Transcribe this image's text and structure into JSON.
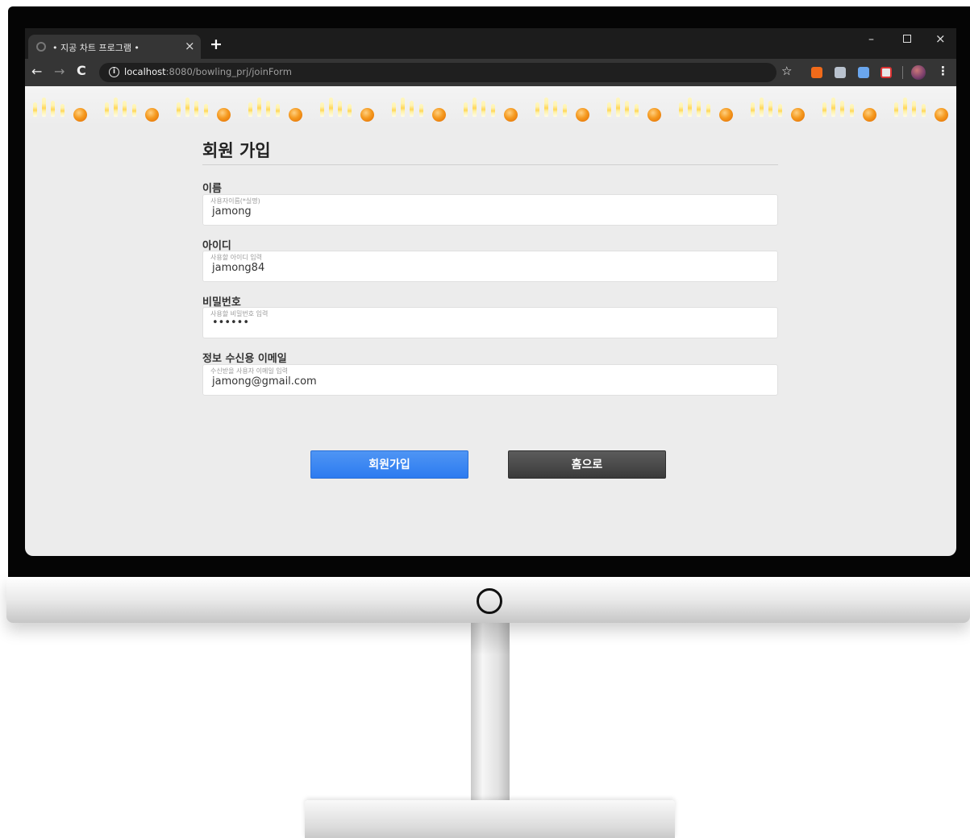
{
  "browser": {
    "tab_title": "• 지공 차트 프로그램 •",
    "tab_close": "×",
    "new_tab": "+",
    "url_host": "localhost",
    "url_path": ":8080/bowling_prj/joinForm",
    "info": "i",
    "window_controls": {
      "minimize": "–",
      "close": "×"
    },
    "nav": {
      "back": "←",
      "forward": "→",
      "reload": "C",
      "star": "☆",
      "menu": "⋮"
    },
    "extensions": [
      "ext-orange-icon",
      "ext-gray-icon",
      "ext-blue-icon",
      "ext-red-icon"
    ]
  },
  "page": {
    "title": "회원 가입",
    "fields": [
      {
        "label": "이름",
        "placeholder": "사용자이름(*실명)",
        "value": "jamong"
      },
      {
        "label": "아이디",
        "placeholder": "사용할 아이디 입력",
        "value": "jamong84"
      },
      {
        "label": "비밀번호",
        "placeholder": "사용할 비밀번호 입력",
        "value": "••••••"
      },
      {
        "label": "정보 수신용 이메일",
        "placeholder": "수신받을 사용자 이메일 입력",
        "value": "jamong@gmail.com"
      }
    ],
    "buttons": {
      "join": "회원가입",
      "home": "홈으로"
    }
  },
  "colors": {
    "join_button": "#2c7bf0",
    "home_button": "#444444",
    "page_background": "#ececec",
    "bowling_ball": "#f59a20"
  }
}
